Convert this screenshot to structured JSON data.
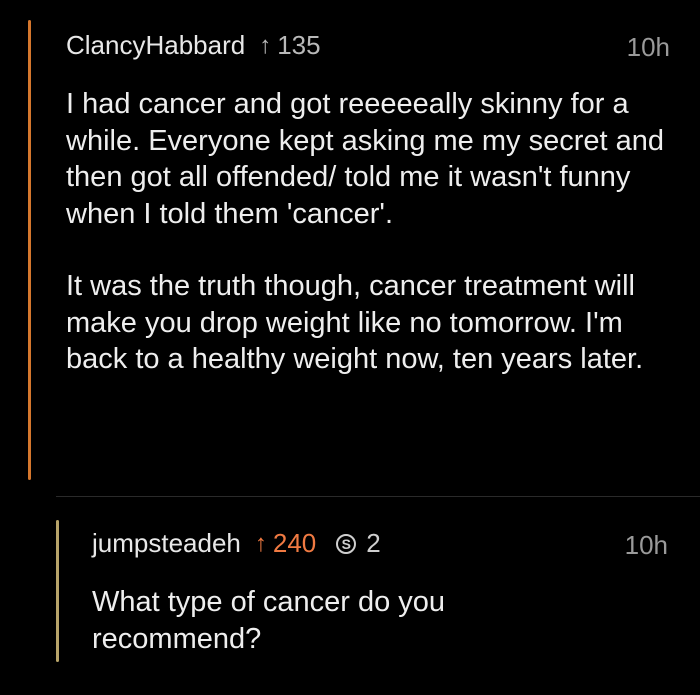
{
  "comments": [
    {
      "username": "ClancyHabbard",
      "score": "135",
      "time": "10h",
      "paragraphs": [
        "I had cancer and got reeeeeally skinny for a while.  Everyone kept asking me my secret and then got all offended/ told me it wasn't funny when I told them 'cancer'.",
        "It was the truth though, cancer treatment will make you drop weight like no tomorrow.  I'm back to a healthy weight now, ten years later."
      ],
      "thread_color": "#d5772d",
      "score_color": "#b9b9b9"
    },
    {
      "username": "jumpsteadeh",
      "score": "240",
      "award_icon": "silver-award-icon",
      "award_count": "2",
      "time": "10h",
      "paragraphs": [
        "What type of cancer do you recommend?"
      ],
      "thread_color": "#b8a46a",
      "score_color": "#f07a42"
    }
  ]
}
